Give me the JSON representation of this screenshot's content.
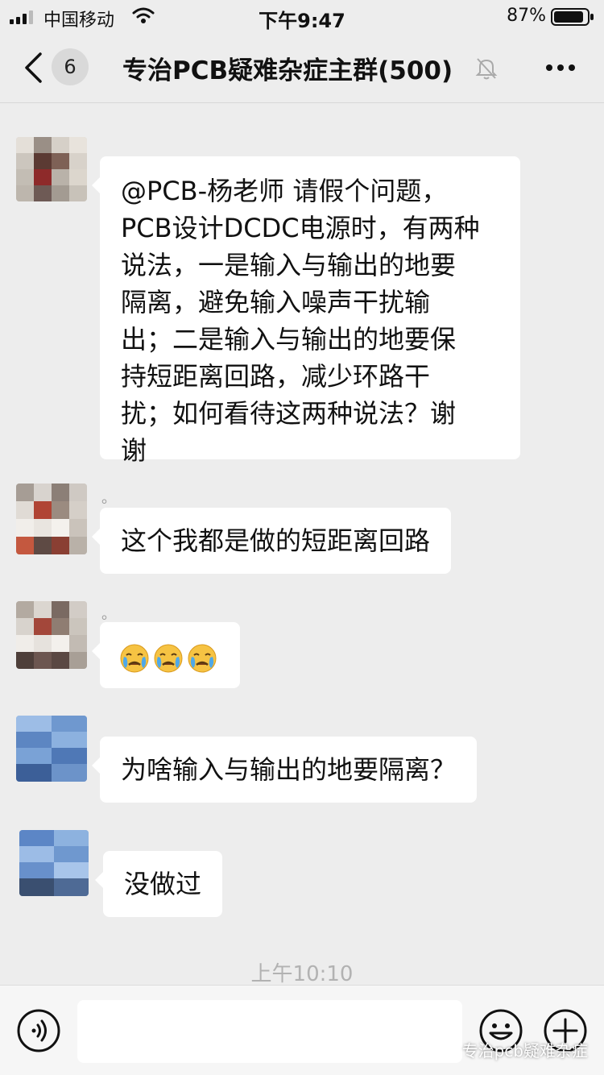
{
  "status_bar": {
    "carrier": "中国移动",
    "time": "下午9:47",
    "battery_percent": "87%",
    "icons": [
      "signal-icon",
      "wifi-icon",
      "battery-icon"
    ]
  },
  "nav": {
    "unread_count": "6",
    "title": "专治PCB疑难杂症主群(500)",
    "icons": [
      "back-arrow-icon",
      "mute-bell-icon",
      "more-icon"
    ]
  },
  "messages": [
    {
      "sender": "",
      "text_lines": [
        "@PCB-杨老师 请假个问题，",
        "PCB设计DCDC电源时，有两种",
        "说法，一是输入与输出的地要",
        "隔离，避免输入噪声干扰输",
        "出；二是输入与输出的地要保",
        "持短距离回路，减少环路干",
        "扰；如何看待这两种说法？谢",
        "谢"
      ]
    },
    {
      "sender": "。",
      "text": "这个我都是做的短距离回路"
    },
    {
      "sender": "。",
      "emoji": [
        "face-with-tears-icon",
        "face-with-tears-icon",
        "face-with-tears-icon"
      ]
    },
    {
      "sender": "",
      "text": "为啥输入与输出的地要隔离？"
    },
    {
      "sender": "",
      "text": "没做过"
    }
  ],
  "timestamp": "上午10:10",
  "input_bar": {
    "placeholder": "",
    "icons": [
      "voice-icon",
      "emoji-icon",
      "plus-icon"
    ]
  },
  "watermark": "专治pcb疑难杂症",
  "colors": {
    "background": "#ededed",
    "bubble": "#ffffff",
    "timestamp": "#b2b2b2"
  }
}
